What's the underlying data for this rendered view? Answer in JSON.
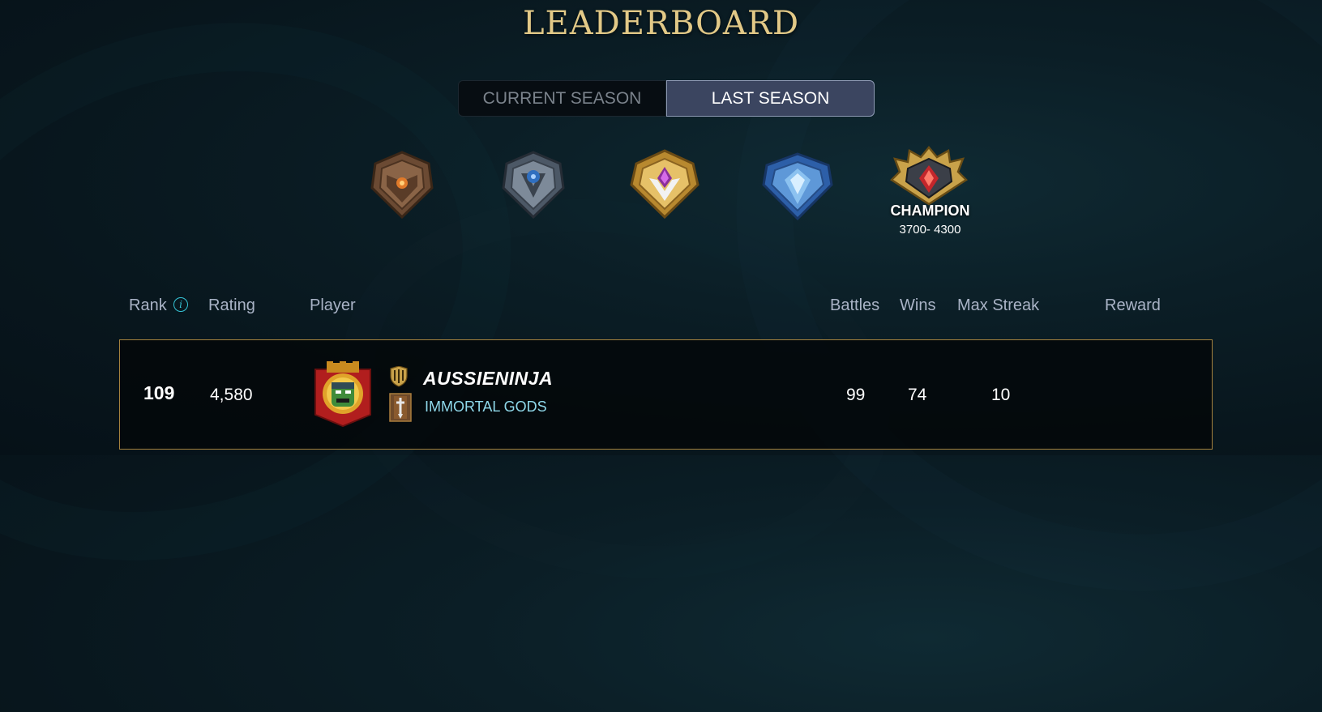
{
  "page": {
    "title": "LEADERBOARD"
  },
  "tabs": {
    "current": "CURRENT SEASON",
    "last": "LAST SEASON",
    "selected": "last"
  },
  "leagues": [
    {
      "name": "bronze",
      "icon": "bronze-league-icon"
    },
    {
      "name": "silver",
      "icon": "silver-league-icon"
    },
    {
      "name": "gold",
      "icon": "gold-league-icon"
    },
    {
      "name": "diamond",
      "icon": "diamond-league-icon"
    },
    {
      "name": "champion",
      "icon": "champion-league-icon",
      "label": "CHAMPION",
      "range": "3700- 4300"
    }
  ],
  "table": {
    "headers": {
      "rank": "Rank",
      "rating": "Rating",
      "player": "Player",
      "battles": "Battles",
      "wins": "Wins",
      "max_streak": "Max Streak",
      "reward": "Reward"
    },
    "rows": [
      {
        "rank": "109",
        "rating": "4,580",
        "player": "AUSSIENINJA",
        "guild": "IMMORTAL GODS",
        "battles": "99",
        "wins": "74",
        "max_streak": "10",
        "reward": ""
      }
    ]
  },
  "colors": {
    "title_gold": "#e2c987",
    "row_border": "#a5823e",
    "guild_text": "#8fd8ea",
    "tab_active": "#3b4560",
    "info_icon": "#35c4d6"
  }
}
